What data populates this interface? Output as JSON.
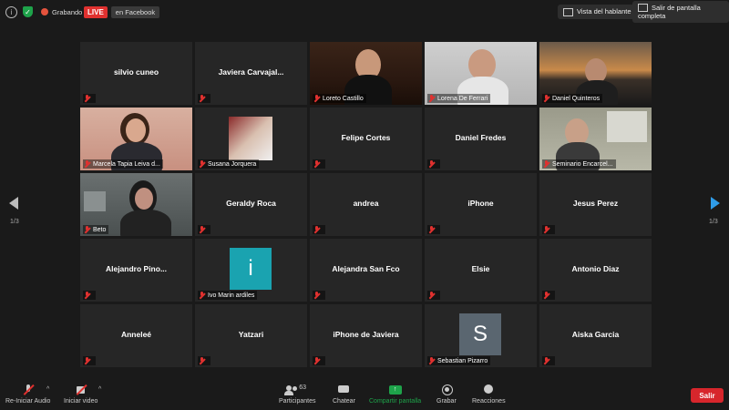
{
  "topbar": {
    "recording_label": "Grabando",
    "live_label": "LIVE",
    "facebook_label": "en Facebook",
    "speaker_view_label": "Vista del hablante",
    "exit_fullscreen_label": "Salir de pantalla completa"
  },
  "colors": {
    "active_speaker": "#c9e84f",
    "live": "#e0312f",
    "share": "#1ea34a",
    "leave": "#d7262c",
    "nav_right": "#2f9ce8"
  },
  "tiles": [
    {
      "name": "silvio cuneo",
      "label": ""
    },
    {
      "name": "Javiera  Carvajal...",
      "label": ""
    },
    {
      "name": "",
      "label": "Loreto Castillo"
    },
    {
      "name": "",
      "label": "Lorena De Ferrari"
    },
    {
      "name": "",
      "label": "Daniel Quinteros"
    },
    {
      "name": "",
      "label": "Marcela Tapia Leiva d..."
    },
    {
      "name": "",
      "label": "Susana Jorquera"
    },
    {
      "name": "Felipe Cortes",
      "label": ""
    },
    {
      "name": "Daniel Fredes",
      "label": ""
    },
    {
      "name": "",
      "label": "Seminario Encarcel..."
    },
    {
      "name": "",
      "label": "Beto"
    },
    {
      "name": "Geraldy Roca",
      "label": ""
    },
    {
      "name": "andrea",
      "label": ""
    },
    {
      "name": "iPhone",
      "label": ""
    },
    {
      "name": "Jesus Perez",
      "label": ""
    },
    {
      "name": "Alejandro  Pino...",
      "label": ""
    },
    {
      "name": "",
      "label": "Ivo Marin ardiles",
      "avatar": "i"
    },
    {
      "name": "Alejandra San Fco",
      "label": ""
    },
    {
      "name": "Elsie",
      "label": ""
    },
    {
      "name": "Antonio Diaz",
      "label": ""
    },
    {
      "name": "Anneleé",
      "label": ""
    },
    {
      "name": "Yatzari",
      "label": ""
    },
    {
      "name": "iPhone de Javiera",
      "label": ""
    },
    {
      "name": "",
      "label": "Sebastian Pizarro",
      "avatar": "S"
    },
    {
      "name": "Aiska Garcia",
      "label": ""
    }
  ],
  "pagination": {
    "left": "1/3",
    "right": "1/3"
  },
  "bottombar": {
    "unmute_label": "Re-Iniciar Audio",
    "video_label": "Iniciar video",
    "participants_label": "Participantes",
    "participants_count": "63",
    "chat_label": "Chatear",
    "share_label": "Compartir pantalla",
    "record_label": "Grabar",
    "reactions_label": "Reacciones",
    "leave_label": "Salir"
  }
}
